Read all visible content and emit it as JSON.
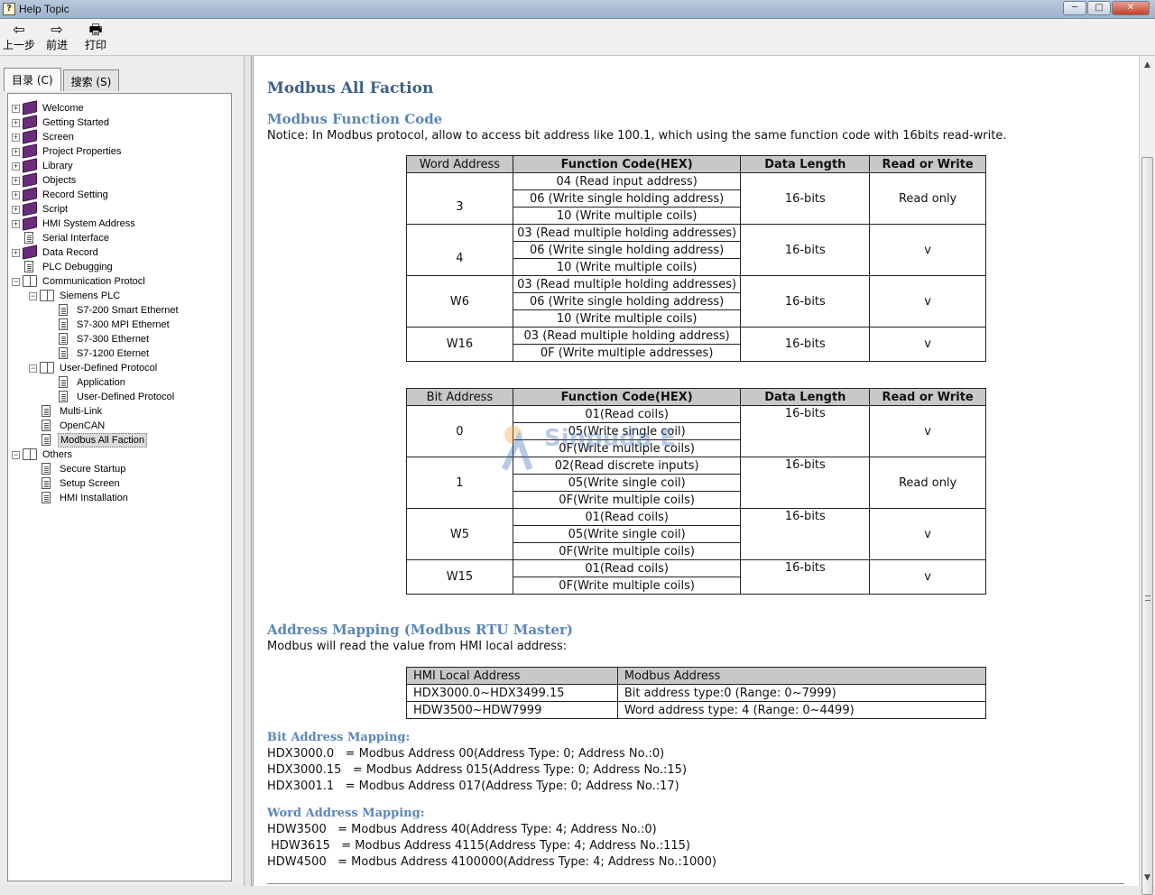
{
  "window": {
    "title": "Help Topic",
    "minimize": "─",
    "maximize": "□",
    "close": "✕"
  },
  "toolbar": {
    "back_label": "上一步",
    "forward_label": "前进",
    "print_label": "打印",
    "back_icon": "arrow-left-icon",
    "forward_icon": "arrow-right-icon",
    "print_icon": "printer-icon"
  },
  "sidebar": {
    "tabs": [
      "目录 (C)",
      "搜索 (S)"
    ],
    "items": [
      {
        "label": "Welcome"
      },
      {
        "label": "Getting Started"
      },
      {
        "label": "Screen"
      },
      {
        "label": "Project Properties"
      },
      {
        "label": "Library"
      },
      {
        "label": "Objects"
      },
      {
        "label": "Record Setting"
      },
      {
        "label": "Script"
      },
      {
        "label": "HMI System Address"
      },
      {
        "label": "Serial Interface"
      },
      {
        "label": "Data Record"
      },
      {
        "label": "PLC Debugging"
      },
      {
        "label": "Communication Protocl"
      },
      {
        "label": "Siemens PLC"
      },
      {
        "label": "S7-200 Smart Ethernet"
      },
      {
        "label": "S7-300 MPI Ethernet"
      },
      {
        "label": "S7-300 Ethernet"
      },
      {
        "label": "S7-1200 Eternet"
      },
      {
        "label": "User-Defined Protocol"
      },
      {
        "label": "Application"
      },
      {
        "label": "User-Defined Protocol"
      },
      {
        "label": "Multi-Link"
      },
      {
        "label": "OpenCAN"
      },
      {
        "label": "Modbus All Faction"
      },
      {
        "label": "Others"
      },
      {
        "label": "Secure Startup"
      },
      {
        "label": "Setup Screen"
      },
      {
        "label": "HMI Installation"
      }
    ]
  },
  "main": {
    "title": "Modbus All Faction",
    "section1_heading": "Modbus Function Code",
    "notice": "Notice: In Modbus protocol, allow to access bit address like 100.1, which using the same function code with 16bits read-write.",
    "word_table": {
      "headers": [
        "Word Address",
        "Function Code(HEX)",
        "Data Length",
        "Read or Write"
      ],
      "groups": [
        {
          "address": "3",
          "codes": [
            "04 (Read input address)",
            "06 (Write single holding address)",
            "10 (Write multiple coils)"
          ],
          "length": "16-bits",
          "rw": "Read only"
        },
        {
          "address": "4",
          "codes": [
            "03 (Read multiple holding addresses)",
            "06 (Write single holding address)",
            "10 (Write multiple coils)"
          ],
          "length": "16-bits",
          "rw": "v"
        },
        {
          "address": "W6",
          "codes": [
            "03 (Read multiple holding addresses)",
            "06 (Write single holding address)",
            "10 (Write multiple coils)"
          ],
          "length": "16-bits",
          "rw": "v"
        },
        {
          "address": "W16",
          "codes": [
            "03 (Read multiple holding address)",
            "0F (Write multiple addresses)"
          ],
          "length": "16-bits",
          "rw": "v"
        }
      ]
    },
    "bit_table": {
      "headers": [
        "Bit Address",
        "Function Code(HEX)",
        "Data Length",
        "Read or Write"
      ],
      "groups": [
        {
          "address": "0",
          "codes": [
            "01(Read coils)",
            "05(Write single coil)",
            "0F(Write multiple coils)"
          ],
          "length": "16-bits",
          "rw": "v"
        },
        {
          "address": "1",
          "codes": [
            "02(Read discrete inputs)",
            "05(Write single coil)",
            "0F(Write multiple coils)"
          ],
          "length": "16-bits",
          "rw": "Read only"
        },
        {
          "address": "W5",
          "codes": [
            "01(Read coils)",
            "05(Write single coil)",
            "0F(Write multiple coils)"
          ],
          "length": "16-bits",
          "rw": "v"
        },
        {
          "address": "W15",
          "codes": [
            "01(Read coils)",
            "0F(Write multiple coils)"
          ],
          "length": "16-bits",
          "rw": "v"
        }
      ]
    },
    "section2_heading": "Address Mapping (Modbus RTU Master)",
    "section2_text": "Modbus will read the value from HMI local address:",
    "map_table": {
      "headers": [
        "HMI Local Address",
        "Modbus Address"
      ],
      "rows": [
        [
          "HDX3000.0~HDX3499.15",
          "Bit address type:0 (Range: 0~7999)"
        ],
        [
          "HDW3500~HDW7999",
          "Word address type: 4 (Range:  0~4499)"
        ]
      ]
    },
    "bit_mapping_heading": "Bit Address Mapping:",
    "bit_mapping_lines": [
      "HDX3000.0   = Modbus Address 00(Address Type: 0; Address No.:0)",
      "HDX3000.15   = Modbus Address 015(Address Type: 0; Address No.:15)",
      "HDX3001.1   = Modbus Address 017(Address Type: 0; Address No.:17)"
    ],
    "word_mapping_heading": "Word Address Mapping:",
    "word_mapping_lines": [
      "HDW3500   = Modbus Address 40(Address Type: 4; Address No.:0)",
      " HDW3615   = Modbus Address 4115(Address Type: 4; Address No.:115)",
      "HDW4500   = Modbus Address 4100000(Address Type: 4; Address No.:1000)"
    ]
  },
  "watermark": "Sinpuda Engineer",
  "colors": {
    "heading": "#3f5f8a",
    "subheading": "#5a86b8",
    "table_header_bg": "#c8c8c8",
    "book_icon": "#6b2c7a"
  }
}
